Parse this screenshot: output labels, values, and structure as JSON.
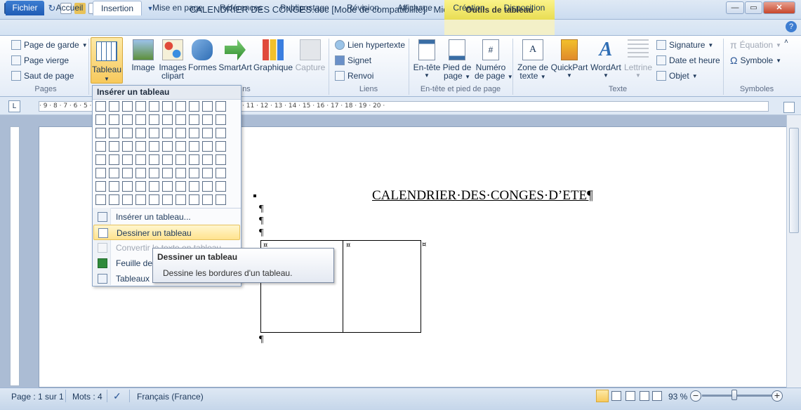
{
  "titlebar": {
    "title": "CALENDRIER DES CONGES.doc [Mode de compatibilité] - Micro...",
    "context_header": "Outils de tableau"
  },
  "tabs": [
    {
      "label": "Fichier"
    },
    {
      "label": "Accueil"
    },
    {
      "label": "Insertion"
    },
    {
      "label": "Mise en page"
    },
    {
      "label": "Références"
    },
    {
      "label": "Publipostage"
    },
    {
      "label": "Révision"
    },
    {
      "label": "Affichage"
    },
    {
      "label": "Création"
    },
    {
      "label": "Disposition"
    }
  ],
  "ribbon": {
    "pages": {
      "label": "Pages",
      "items": [
        "Page de garde",
        "Page vierge",
        "Saut de page"
      ]
    },
    "tableau": {
      "line1": "Tableau"
    },
    "illustrations": {
      "image": "Image",
      "images_clipart_1": "Images",
      "images_clipart_2": "clipart",
      "formes": "Formes",
      "smartart": "SmartArt",
      "graphique": "Graphique",
      "capture": "Capture",
      "label_tail": "ns"
    },
    "liens": {
      "label": "Liens",
      "items": [
        "Lien hypertexte",
        "Signet",
        "Renvoi"
      ]
    },
    "entete": {
      "label": "En-tête et pied de page",
      "entete": "En-tête",
      "pied_1": "Pied de",
      "pied_2": "page",
      "numero_1": "Numéro",
      "numero_2": "de page"
    },
    "texte": {
      "label": "Texte",
      "zone_1": "Zone de",
      "zone_2": "texte",
      "quickpart": "QuickPart",
      "wordart": "WordArt",
      "lettrine": "Lettrine",
      "signature": "Signature",
      "date": "Date et heure",
      "objet": "Objet"
    },
    "symboles": {
      "label": "Symboles",
      "equation": "Équation",
      "symbole": "Symbole"
    }
  },
  "ruler": {
    "text": "· 9 · 8 · 7 · 6 · 5 · 4 · 3 · 2 · 1 · · · 1 · 2 · 3 · 4 · 5 · 6 · 7 · 8 · 9 · 10 · 11 · 12 · 13 · 14 · 15 · 16 · 17 · 18 · 19 · 20 ·"
  },
  "document": {
    "title": "CALENDRIER·DES·CONGES·D’ETE¶",
    "pilcrow": "¶",
    "cell_mark": "¤"
  },
  "dropdown": {
    "header": "Insérer un tableau",
    "grid_cols": 10,
    "grid_rows": 8,
    "items": [
      {
        "label": "Insérer un tableau..."
      },
      {
        "label": "Dessiner un tableau"
      },
      {
        "label": "Convertir le texte en tableau"
      },
      {
        "label": "Feuille de"
      },
      {
        "label": "Tableaux r"
      }
    ]
  },
  "tooltip": {
    "title": "Dessiner un tableau",
    "description": "Dessine les bordures d'un tableau."
  },
  "statusbar": {
    "page": "Page : 1 sur 1",
    "words": "Mots : 4",
    "language": "Français (France)",
    "zoom": "93 %"
  }
}
